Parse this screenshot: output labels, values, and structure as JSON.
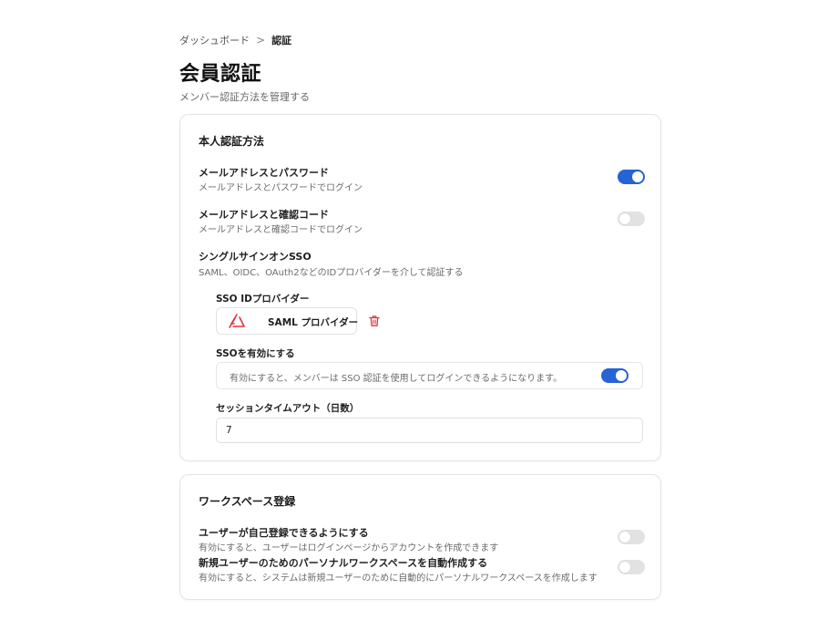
{
  "breadcrumb": {
    "parent": "ダッシュボード",
    "separator": ">",
    "current": "認証"
  },
  "page": {
    "title": "会員認証",
    "subtitle": "メンバー認証方法を管理する"
  },
  "identity": {
    "title": "本人認証方法",
    "email_password": {
      "title": "メールアドレスとパスワード",
      "desc": "メールアドレスとパスワードでログイン",
      "enabled": true
    },
    "email_code": {
      "title": "メールアドレスと確認コード",
      "desc": "メールアドレスと確認コードでログイン",
      "enabled": false
    },
    "sso": {
      "title": "シングルサインオンSSO",
      "desc": "SAML、OIDC、OAuth2などのIDプロバイダーを介して認証する",
      "provider_label": "SSO IDプロバイダー",
      "provider_name": "SAML プロバイダー",
      "provider_icon": "saml-logo-icon",
      "delete_icon": "trash-icon",
      "enable_label": "SSOを有効にする",
      "enable_hint": "有効にすると、メンバーは SSO 認証を使用してログインできるようになります。",
      "enable_on": true,
      "timeout_label": "セッションタイムアウト（日数）",
      "timeout_value": "7"
    }
  },
  "workspace": {
    "title": "ワークスペース登録",
    "self_signup": {
      "title": "ユーザーが自己登録できるようにする",
      "desc": "有効にすると、ユーザーはログインページからアカウントを作成できます",
      "enabled": false
    },
    "auto_workspace": {
      "title": "新規ユーザーのためのパーソナルワークスペースを自動作成する",
      "desc": "有効にすると、システムは新規ユーザーのために自動的にパーソナルワークスペースを作成します",
      "enabled": false
    }
  },
  "colors": {
    "accent": "#2563d6",
    "toggle_off": "#e2e2e2",
    "danger": "#e0343a"
  }
}
